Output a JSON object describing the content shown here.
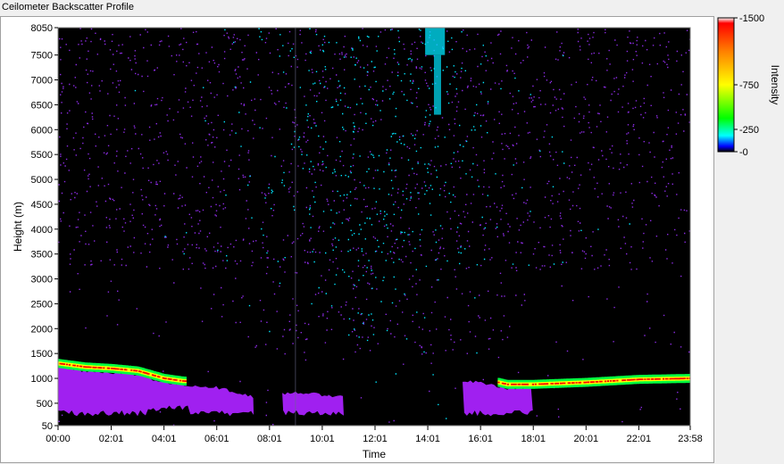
{
  "window": {
    "title": "Ceilometer Backscatter Profile"
  },
  "colors": {
    "background": "#000000",
    "noise": "#8a2be2",
    "cloud_base": "#a020f0",
    "cyan": "#00e5ff",
    "green": "#00ff40",
    "yellow": "#ffff00",
    "red": "#ff0000"
  },
  "chart_data": {
    "type": "heatmap",
    "title": "",
    "xlabel": "Time",
    "ylabel": "Height (m)",
    "x_ticks": [
      "00:00",
      "02:01",
      "04:01",
      "06:01",
      "08:01",
      "10:01",
      "12:01",
      "14:01",
      "16:01",
      "18:01",
      "20:01",
      "22:01",
      "23:58"
    ],
    "x_tick_minutes": [
      0,
      121,
      241,
      361,
      481,
      601,
      721,
      841,
      961,
      1081,
      1201,
      1321,
      1438
    ],
    "y_ticks": [
      8050,
      7500,
      7000,
      6500,
      6000,
      5500,
      5000,
      4500,
      4000,
      3500,
      3000,
      2500,
      2000,
      1500,
      1000,
      500,
      50
    ],
    "ylim": [
      50,
      8050
    ],
    "xlim_minutes": [
      0,
      1438
    ],
    "colorbar": {
      "label": "Intensity",
      "ticks": [
        1500,
        750,
        250,
        0
      ],
      "range": [
        0,
        1500
      ],
      "stops": [
        "#000000",
        "#0000ff",
        "#00ffff",
        "#00ff00",
        "#ffff00",
        "#ff8000",
        "#ff0000",
        "#ffffff"
      ]
    },
    "features": {
      "aerosol_layer_top": [
        {
          "t": 0,
          "h": 1300
        },
        {
          "t": 60,
          "h": 1230
        },
        {
          "t": 120,
          "h": 1200
        },
        {
          "t": 180,
          "h": 1150
        },
        {
          "t": 240,
          "h": 1000
        },
        {
          "t": 280,
          "h": 950
        },
        {
          "t": 360,
          "h": 900
        },
        {
          "t": 450,
          "h": 700
        },
        {
          "t": 540,
          "h": 800
        },
        {
          "t": 660,
          "h": 700
        },
        {
          "t": 860,
          "h": 1050
        },
        {
          "t": 960,
          "h": 1000
        },
        {
          "t": 1020,
          "h": 880
        },
        {
          "t": 1080,
          "h": 880
        },
        {
          "t": 1200,
          "h": 920
        },
        {
          "t": 1320,
          "h": 980
        },
        {
          "t": 1438,
          "h": 1000
        }
      ],
      "cloud_base_strip_minutes": [
        [
          850,
          1000
        ],
        [
          1000,
          1438
        ],
        [
          0,
          290
        ]
      ],
      "cirrus_minutes": [
        [
          835,
          880
        ]
      ]
    }
  }
}
